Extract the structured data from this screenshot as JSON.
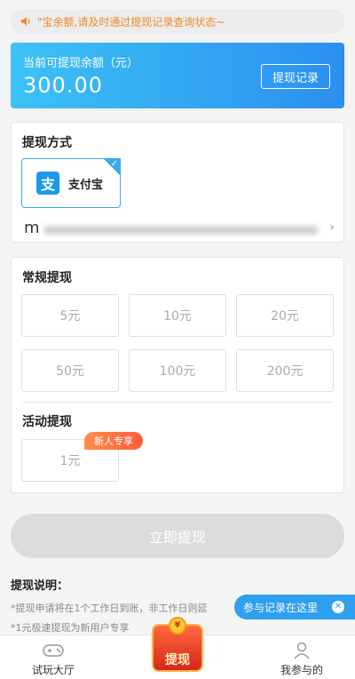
{
  "notice": {
    "text": "\"宝余额,请及时通过提现记录查询状态~"
  },
  "balance": {
    "label": "当前可提现余额（元）",
    "amount": "300.00",
    "record_button": "提现记录"
  },
  "method": {
    "title": "提现方式",
    "option_label": "支付宝",
    "option_logo": "支",
    "account_prefix": "m"
  },
  "amounts": {
    "regular_title": "常规提现",
    "regular_options": [
      "5元",
      "10元",
      "20元",
      "50元",
      "100元",
      "200元"
    ],
    "activity_title": "活动提现",
    "activity_option": "1元",
    "new_user_badge": "新人专享"
  },
  "submit_label": "立即提现",
  "notes": {
    "title": "提现说明：",
    "items": [
      "*提现申请将在1个工作日到账，非工作日则延",
      "*1元极速提现为新用户专享"
    ]
  },
  "tooltip": {
    "text": "参与记录在这里",
    "close": "✕"
  },
  "tabs": [
    {
      "label": "试玩大厅"
    },
    {
      "label": "提现"
    },
    {
      "label": "我参与的"
    }
  ],
  "colors": {
    "accent": "#2b8ff0",
    "notice_text": "#f08a2c",
    "badge": "#ff5a36"
  }
}
